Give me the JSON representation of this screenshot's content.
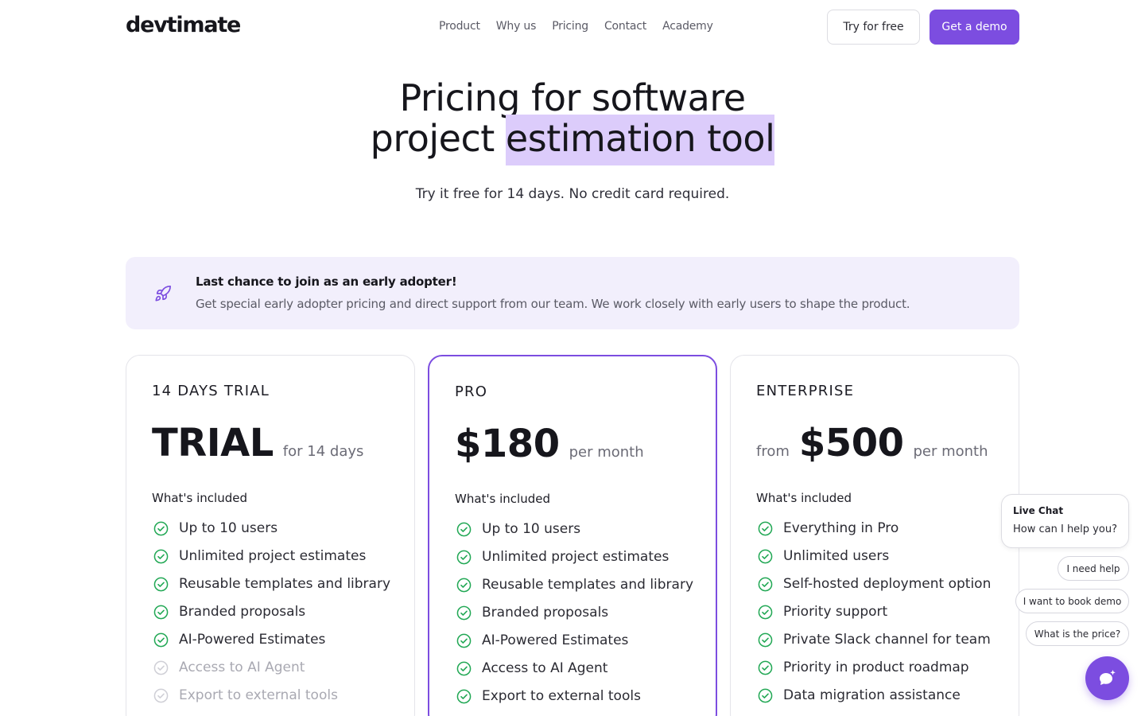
{
  "header": {
    "logo": "devtimate",
    "nav": [
      "Product",
      "Why us",
      "Pricing",
      "Contact",
      "Academy"
    ],
    "try_free": "Try for free",
    "get_demo": "Get a demo"
  },
  "hero": {
    "title_line1": "Pricing for software",
    "title_line2_prefix": "project ",
    "title_line2_highlight": "estimation tool",
    "subtitle": "Try it free for 14 days. No credit card required."
  },
  "banner": {
    "icon": "rocket-icon",
    "title": "Last chance to join as an early adopter!",
    "text": "Get special early adopter pricing and direct support from our team. We work closely with early users to shape the product."
  },
  "plans": [
    {
      "name": "14 DAYS TRIAL",
      "price_prefix": "",
      "price": "TRIAL",
      "period": "for 14 days",
      "included_label": "What's included",
      "features": [
        {
          "text": "Up to 10 users",
          "enabled": true
        },
        {
          "text": "Unlimited project estimates",
          "enabled": true
        },
        {
          "text": "Reusable templates and library",
          "enabled": true
        },
        {
          "text": "Branded proposals",
          "enabled": true
        },
        {
          "text": "AI-Powered Estimates",
          "enabled": true
        },
        {
          "text": "Access to AI Agent",
          "enabled": false
        },
        {
          "text": "Export to external tools",
          "enabled": false
        }
      ]
    },
    {
      "name": "PRO",
      "price_prefix": "",
      "price": "$180",
      "period": "per month",
      "included_label": "What's included",
      "features": [
        {
          "text": "Up to 10 users",
          "enabled": true
        },
        {
          "text": "Unlimited project estimates",
          "enabled": true
        },
        {
          "text": "Reusable templates and library",
          "enabled": true
        },
        {
          "text": "Branded proposals",
          "enabled": true
        },
        {
          "text": "AI-Powered Estimates",
          "enabled": true
        },
        {
          "text": "Access to AI Agent",
          "enabled": true
        },
        {
          "text": "Export to external tools",
          "enabled": true
        }
      ]
    },
    {
      "name": "ENTERPRISE",
      "price_prefix": "from",
      "price": "$500",
      "period": "per month",
      "included_label": "What's included",
      "features": [
        {
          "text": "Everything in Pro",
          "enabled": true
        },
        {
          "text": "Unlimited users",
          "enabled": true
        },
        {
          "text": "Self-hosted deployment option",
          "enabled": true
        },
        {
          "text": "Priority support",
          "enabled": true
        },
        {
          "text": "Private Slack channel for team",
          "enabled": true
        },
        {
          "text": "Priority in product roadmap",
          "enabled": true
        },
        {
          "text": "Data migration assistance",
          "enabled": true
        }
      ]
    }
  ],
  "chat": {
    "title": "Live Chat",
    "text": "How can I help you?",
    "options": [
      "I need help",
      "I want to book demo",
      "What is the price?"
    ],
    "fab_icon": "chat-sparkle-icon"
  },
  "colors": {
    "accent": "#7c4de0",
    "highlight": "#dcccfb",
    "banner_bg": "#f2effc",
    "check_green": "#22a855"
  }
}
